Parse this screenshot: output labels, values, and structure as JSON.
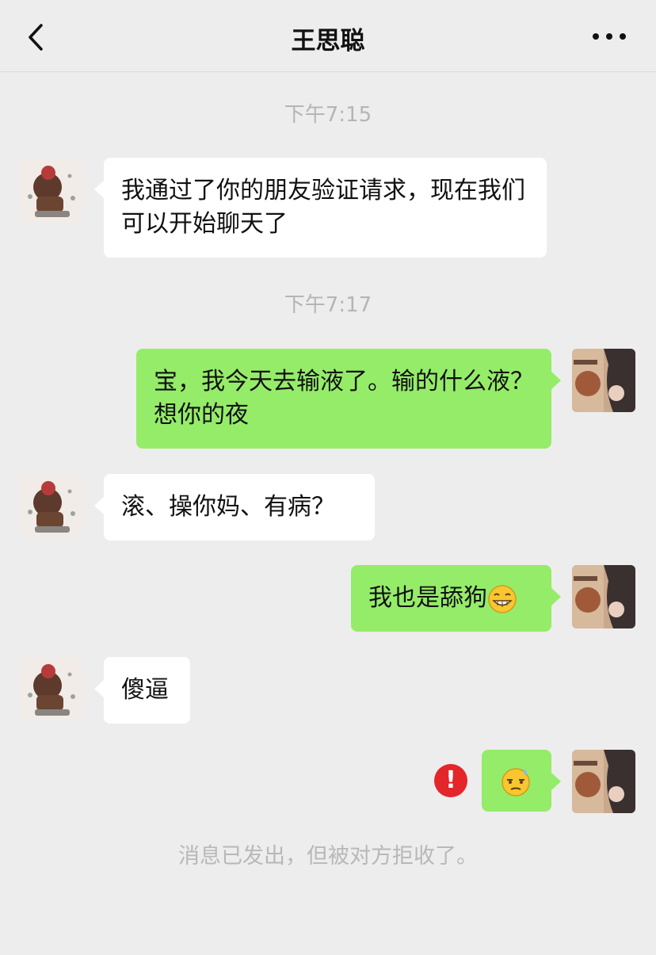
{
  "header": {
    "title": "王思聪",
    "back_icon": "chevron-left-icon",
    "more_icon": "more-dots-icon"
  },
  "messages": {
    "t1": "下午7:15",
    "m1": "我通过了你的朋友验证请求，现在我们可以开始聊天了",
    "t2": "下午7:17",
    "m2": "宝，我今天去输液了。输的什么液？想你的夜",
    "m3": "滚、操你妈、有病？",
    "m4": "我也是舔狗",
    "m5": "傻逼",
    "m6_emoji": "sweat-emoji"
  },
  "status": {
    "error_icon": "!",
    "notice": "消息已发出，但被对方拒收了。"
  },
  "colors": {
    "background": "#ededed",
    "self_bubble": "#95ec69",
    "other_bubble": "#ffffff",
    "error": "#e3262a"
  }
}
